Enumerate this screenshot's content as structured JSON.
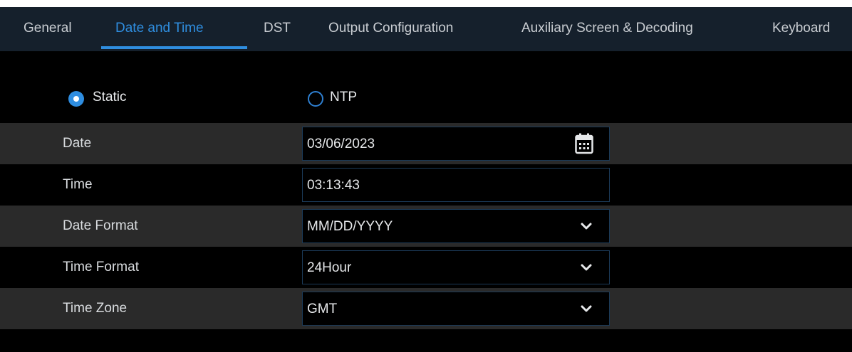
{
  "tabs": [
    {
      "label": "General",
      "active": false
    },
    {
      "label": "Date and Time",
      "active": true
    },
    {
      "label": "DST",
      "active": false
    },
    {
      "label": "Output Configuration",
      "active": false
    },
    {
      "label": "Auxiliary Screen & Decoding",
      "active": false
    },
    {
      "label": "Keyboard",
      "active": false
    }
  ],
  "mode": {
    "options": [
      {
        "label": "Static",
        "selected": true
      },
      {
        "label": "NTP",
        "selected": false
      }
    ]
  },
  "form": {
    "date": {
      "label": "Date",
      "value": "03/06/2023",
      "icon": "calendar-icon"
    },
    "time": {
      "label": "Time",
      "value": "03:13:43"
    },
    "date_format": {
      "label": "Date Format",
      "value": "MM/DD/YYYY",
      "icon": "chevron-down-icon"
    },
    "time_format": {
      "label": "Time Format",
      "value": "24Hour",
      "icon": "chevron-down-icon"
    },
    "time_zone": {
      "label": "Time Zone",
      "value": "GMT",
      "icon": "chevron-down-icon"
    }
  },
  "colors": {
    "accent": "#2f8ee0",
    "tabbar_bg": "#15202c",
    "row_alt_bg": "#2a2a2a",
    "field_border": "#1b3a58"
  }
}
